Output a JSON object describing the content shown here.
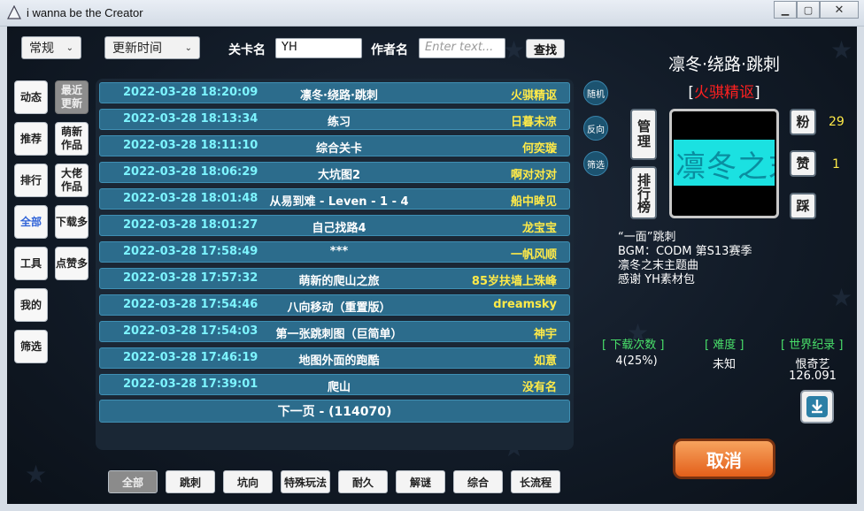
{
  "window": {
    "title": "i wanna be the Creator"
  },
  "filters": {
    "category_select": "常规",
    "sort_select": "更新时间",
    "level_name_label": "关卡名",
    "level_name_value": "YH",
    "author_label": "作者名",
    "author_placeholder": "Enter text...",
    "search_label": "查找"
  },
  "left_tabs": [
    "动态",
    "推荐",
    "排行",
    "全部",
    "工具",
    "我的",
    "筛选"
  ],
  "right_tabs": [
    "最近\n更新",
    "萌新\n作品",
    "大佬\n作品",
    "下载多",
    "点赞多"
  ],
  "levels": [
    {
      "date": "2022-03-28 18:20:09",
      "name": "凛冬·绕路·跳刺",
      "author": "火骐精讴"
    },
    {
      "date": "2022-03-28 18:13:34",
      "name": "练习",
      "author": "日暮未凉"
    },
    {
      "date": "2022-03-28 18:11:10",
      "name": "综合关卡",
      "author": "何奕璇"
    },
    {
      "date": "2022-03-28 18:06:29",
      "name": "大坑图2",
      "author": "啊对对对"
    },
    {
      "date": "2022-03-28 18:01:48",
      "name": "从易到难 - Leven - 1 - 4",
      "author": "船中眸见"
    },
    {
      "date": "2022-03-28 18:01:27",
      "name": "自己找路4",
      "author": "龙宝宝"
    },
    {
      "date": "2022-03-28 17:58:49",
      "name": "***",
      "author": "一帆风顺"
    },
    {
      "date": "2022-03-28 17:57:32",
      "name": "萌新的爬山之旅",
      "author": "85岁扶墙上珠峰"
    },
    {
      "date": "2022-03-28 17:54:46",
      "name": "八向移动（重置版）",
      "author": "dreamsky"
    },
    {
      "date": "2022-03-28 17:54:03",
      "name": "第一张跳刺图（巨简单）",
      "author": "神宇"
    },
    {
      "date": "2022-03-28 17:46:19",
      "name": "地图外面的跑酷",
      "author": "如意"
    },
    {
      "date": "2022-03-28 17:39:01",
      "name": "爬山",
      "author": "没有名"
    }
  ],
  "next_page": "下一页 - (114070)",
  "side_round": [
    "随机",
    "反向",
    "筛选"
  ],
  "categories": [
    "全部",
    "跳刺",
    "坑向",
    "特殊玩法",
    "耐久",
    "解谜",
    "综合",
    "长流程"
  ],
  "detail": {
    "title": "凛冬·绕路·跳刺",
    "author_open": "[",
    "author": "火骐精讴",
    "author_close": "]",
    "manage": "管理",
    "ranking": "排行榜",
    "preview_text": "凛冬之末",
    "fans_label": "粉",
    "fans": "29",
    "like_label": "赞",
    "likes": "1",
    "dislike_label": "踩",
    "desc": [
      "“一面”跳刺",
      "BGM：CODM 第S13赛季",
      "凛冬之末主题曲",
      "感谢 YH素材包"
    ],
    "downloads_label": "[ 下载次数 ]",
    "downloads": "4(25%)",
    "difficulty_label": "[ 难度 ]",
    "difficulty": "未知",
    "record_label": "[ 世界纪录 ]",
    "record_holder": "恨奇艺",
    "record_time": "126.091",
    "cancel": "取消"
  }
}
